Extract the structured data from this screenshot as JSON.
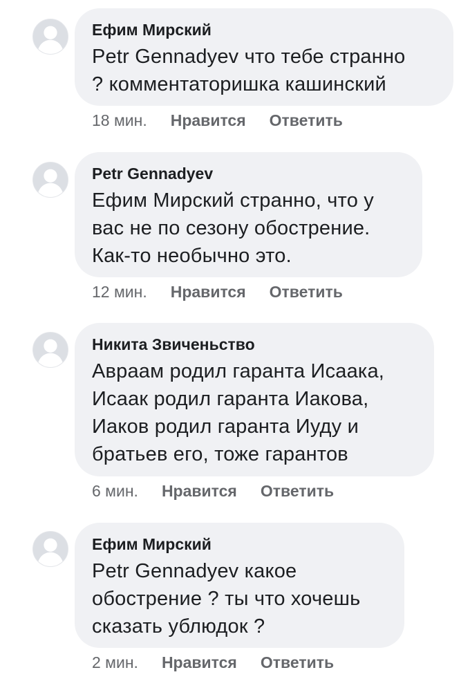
{
  "comments": [
    {
      "author": "Ефим Мирский",
      "lines": [
        "Petr Gennadyev что тебе странно",
        "? комментаторишка кашинский"
      ],
      "time": "18 мин.",
      "like_label": "Нравится",
      "reply_label": "Ответить"
    },
    {
      "author": "Petr Gennadyev",
      "lines": [
        "Ефим Мирский странно, что у",
        "вас не по сезону обострение.",
        "Как-то необычно это."
      ],
      "time": "12 мин.",
      "like_label": "Нравится",
      "reply_label": "Ответить"
    },
    {
      "author": "Никита Звиченьство",
      "lines": [
        "Авраам родил гаранта Исаака,",
        "Исаак родил гаранта Иакова,",
        "Иаков родил гаранта Иуду и",
        "братьев его, тоже гарантов"
      ],
      "time": "6 мин.",
      "like_label": "Нравится",
      "reply_label": "Ответить"
    },
    {
      "author": "Ефим Мирский",
      "lines": [
        "Petr Gennadyev какое",
        "обострение ? ты что хочешь",
        "сказать ублюдок ?"
      ],
      "time": "2 мин.",
      "like_label": "Нравится",
      "reply_label": "Ответить"
    }
  ],
  "colors": {
    "bubble_bg": "#f0f1f4",
    "text": "#1c1e21",
    "secondary": "#65676b",
    "avatar_bg": "#dcdfe4"
  },
  "icons": {
    "avatar": "default-profile-silhouette-icon"
  }
}
